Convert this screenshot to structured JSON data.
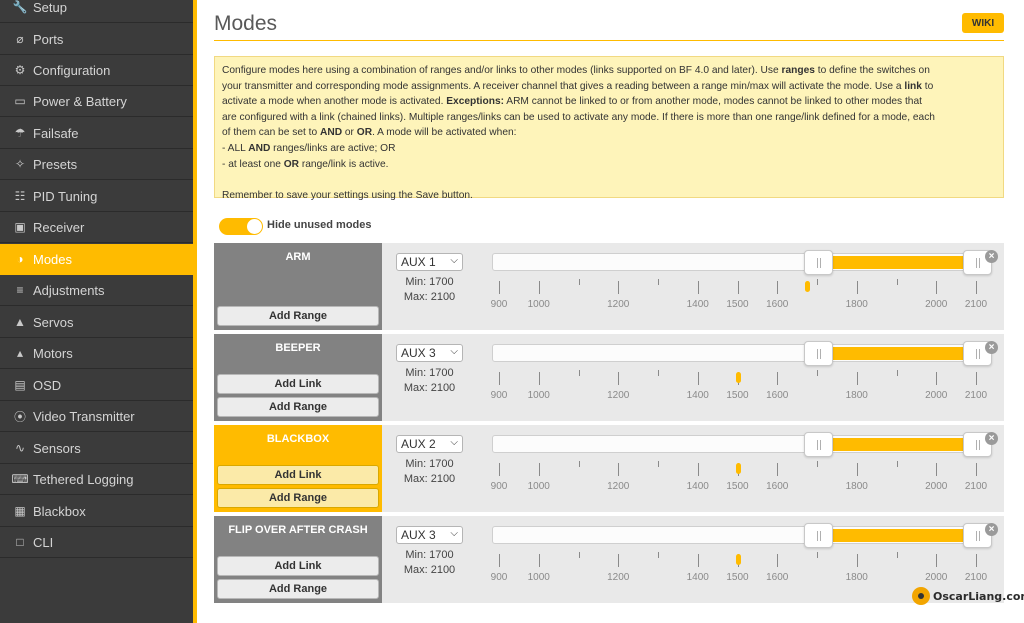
{
  "sidebar": {
    "items": [
      {
        "label": "Setup",
        "icon": "wrench-icon",
        "glyph": "🔧",
        "active": false
      },
      {
        "label": "Ports",
        "icon": "plug-icon",
        "glyph": "⌀",
        "active": false
      },
      {
        "label": "Configuration",
        "icon": "gear-icon",
        "glyph": "⚙",
        "active": false
      },
      {
        "label": "Power & Battery",
        "icon": "battery-icon",
        "glyph": "▭",
        "active": false
      },
      {
        "label": "Failsafe",
        "icon": "parachute-icon",
        "glyph": "☂",
        "active": false
      },
      {
        "label": "Presets",
        "icon": "magic-wand-icon",
        "glyph": "✧",
        "active": false
      },
      {
        "label": "PID Tuning",
        "icon": "sitemap-icon",
        "glyph": "☷",
        "active": false
      },
      {
        "label": "Receiver",
        "icon": "robot-icon",
        "glyph": "▣",
        "active": false
      },
      {
        "label": "Modes",
        "icon": "toggle-icon",
        "glyph": "◑",
        "active": true
      },
      {
        "label": "Adjustments",
        "icon": "sliders-icon",
        "glyph": "≡",
        "active": false
      },
      {
        "label": "Servos",
        "icon": "servo-icon",
        "glyph": "▲",
        "active": false
      },
      {
        "label": "Motors",
        "icon": "motor-icon",
        "glyph": "▴",
        "active": false
      },
      {
        "label": "OSD",
        "icon": "osd-icon",
        "glyph": "▤",
        "active": false
      },
      {
        "label": "Video Transmitter",
        "icon": "broadcast-icon",
        "glyph": "⦿",
        "active": false
      },
      {
        "label": "Sensors",
        "icon": "pulse-icon",
        "glyph": "∿",
        "active": false
      },
      {
        "label": "Tethered Logging",
        "icon": "keyboard-icon",
        "glyph": "⌨",
        "active": false
      },
      {
        "label": "Blackbox",
        "icon": "chip-icon",
        "glyph": "▦",
        "active": false
      },
      {
        "label": "CLI",
        "icon": "terminal-icon",
        "glyph": "□",
        "active": false
      }
    ]
  },
  "header": {
    "title": "Modes",
    "wiki_label": "WIKI"
  },
  "help": {
    "lines": [
      [
        {
          "t": "Configure modes here using a combination of ranges and/or links to other modes (links supported on BF 4.0 and later). Use "
        },
        {
          "t": "ranges",
          "b": true
        },
        {
          "t": " to define the switches on"
        }
      ],
      [
        {
          "t": "your transmitter and corresponding mode assignments. A receiver channel that gives a reading between a range min/max will activate the mode. Use a "
        },
        {
          "t": "link",
          "b": true
        },
        {
          "t": " to"
        }
      ],
      [
        {
          "t": "activate a mode when another mode is activated. "
        },
        {
          "t": "Exceptions:",
          "b": true
        },
        {
          "t": " ARM cannot be linked to or from another mode, modes cannot be linked to other modes that"
        }
      ],
      [
        {
          "t": "are configured with a link (chained links). Multiple ranges/links can be used to activate any mode. If there is more than one range/link defined for a mode, each"
        }
      ],
      [
        {
          "t": "of them can be set to "
        },
        {
          "t": "AND",
          "b": true
        },
        {
          "t": " or "
        },
        {
          "t": "OR",
          "b": true
        },
        {
          "t": ". A mode will be activated when:"
        }
      ],
      [
        {
          "t": "- ALL "
        },
        {
          "t": "AND",
          "b": true
        },
        {
          "t": " ranges/links are active; OR"
        }
      ],
      [
        {
          "t": "- at least one "
        },
        {
          "t": "OR",
          "b": true
        },
        {
          "t": " range/link is active."
        }
      ],
      [
        {
          "t": ""
        }
      ],
      [
        {
          "t": "Remember to save your settings using the Save button."
        }
      ]
    ]
  },
  "toggle": {
    "label": "Hide unused modes",
    "on": true
  },
  "scale": {
    "min": 900,
    "max": 2100,
    "major_ticks": [
      900,
      1000,
      1200,
      1400,
      1500,
      1600,
      1800,
      2000,
      2100
    ],
    "minor_ticks": [
      1100,
      1300,
      1700,
      1900
    ]
  },
  "modes": [
    {
      "name": "ARM",
      "aux": "AUX 1",
      "min_label": "Min: 1700",
      "max_label": "Max: 2100",
      "range_min": 1700,
      "range_max": 2100,
      "channel_value": 1675,
      "buttons": [
        "Add Range"
      ],
      "highlight": false
    },
    {
      "name": "BEEPER",
      "aux": "AUX 3",
      "min_label": "Min: 1700",
      "max_label": "Max: 2100",
      "range_min": 1700,
      "range_max": 2100,
      "channel_value": 1500,
      "buttons": [
        "Add Link",
        "Add Range"
      ],
      "highlight": false
    },
    {
      "name": "BLACKBOX",
      "aux": "AUX 2",
      "min_label": "Min: 1700",
      "max_label": "Max: 2100",
      "range_min": 1700,
      "range_max": 2100,
      "channel_value": 1500,
      "buttons": [
        "Add Link",
        "Add Range"
      ],
      "highlight": true
    },
    {
      "name": "FLIP OVER AFTER CRASH",
      "aux": "AUX 3",
      "min_label": "Min: 1700",
      "max_label": "Max: 2100",
      "range_min": 1700,
      "range_max": 2100,
      "channel_value": 1500,
      "buttons": [
        "Add Link",
        "Add Range"
      ],
      "highlight": false
    }
  ],
  "watermark": "OscarLiang.com",
  "colors": {
    "accent": "#ffbb00",
    "sidebar_bg": "#3b3b3b",
    "note_bg": "#fef4ba"
  }
}
